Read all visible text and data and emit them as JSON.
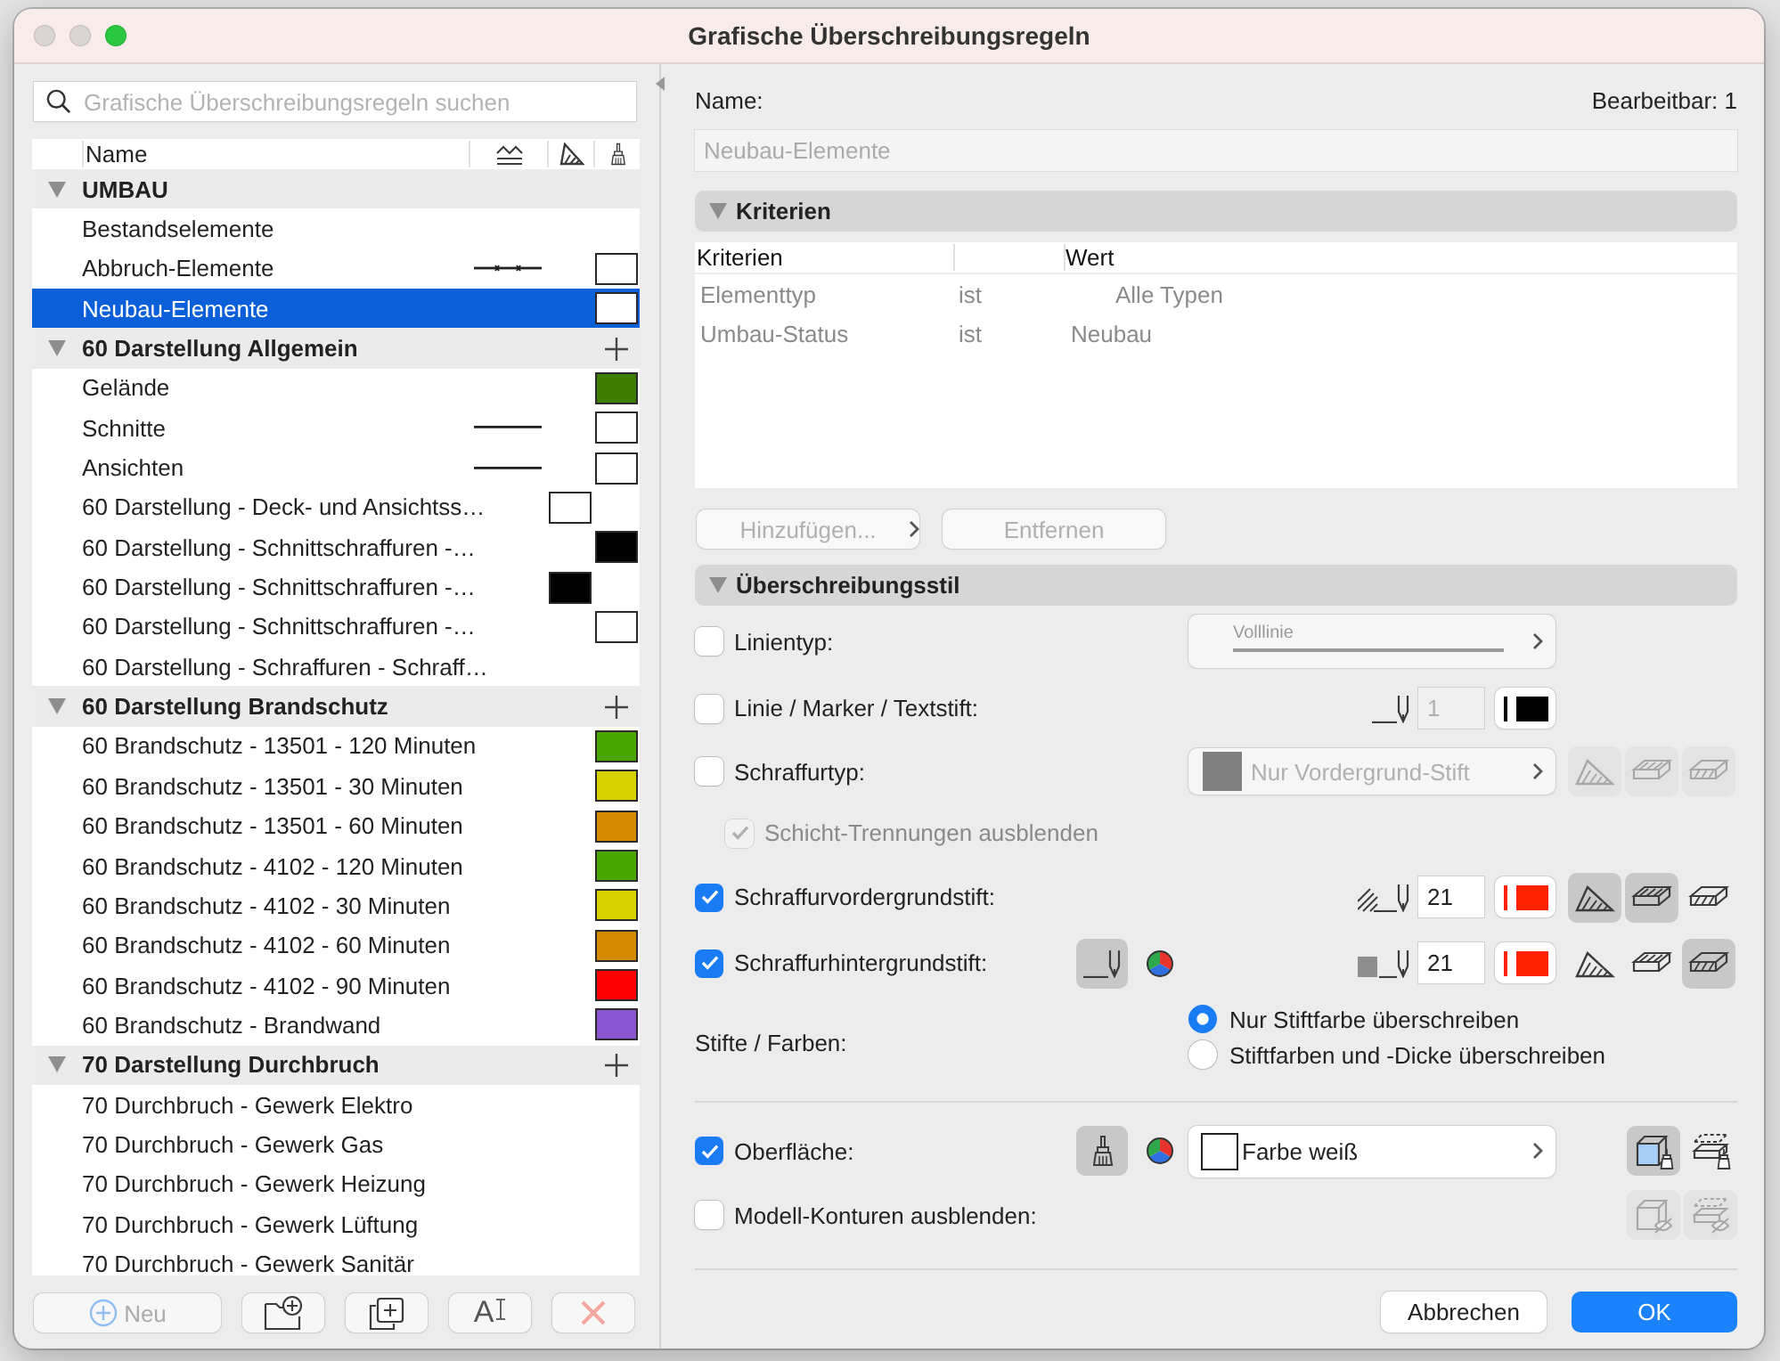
{
  "window": {
    "title": "Grafische Überschreibungsregeln",
    "controls": [
      {
        "kind": "close",
        "disabled": true
      },
      {
        "kind": "minimize",
        "disabled": true
      },
      {
        "kind": "zoom",
        "disabled": false
      }
    ]
  },
  "rule_list": {
    "search": {
      "placeholder": "Grafische Überschreibungsregeln suchen"
    },
    "columns": [
      {
        "kind": "name",
        "label": "Name"
      },
      {
        "kind": "line"
      },
      {
        "kind": "fill"
      },
      {
        "kind": "surface"
      }
    ],
    "groups": [
      {
        "label": "UMBAU",
        "expanded": true,
        "addable": false,
        "items": [
          {
            "label": "Bestandselemente",
            "selected": false
          },
          {
            "label": "Abbruch-Elemente",
            "selected": false,
            "line": {
              "kind": "crossed"
            },
            "surface": {
              "color": "#ffffff"
            }
          },
          {
            "label": "Neubau-Elemente",
            "selected": true,
            "surface": {
              "color": "#ffffff"
            }
          }
        ]
      },
      {
        "label": "60 Darstellung Allgemein",
        "expanded": true,
        "addable": true,
        "items": [
          {
            "label": "Gelände",
            "selected": false,
            "surface": {
              "color": "#3e7d00"
            }
          },
          {
            "label": "Schnitte",
            "selected": false,
            "line": {
              "kind": "solid"
            },
            "surface": {
              "color": "#ffffff"
            }
          },
          {
            "label": "Ansichten",
            "selected": false,
            "line": {
              "kind": "solid"
            },
            "surface": {
              "color": "#ffffff"
            }
          },
          {
            "label": "60 Darstellung - Deck- und Ansichtss…",
            "selected": false,
            "fill": {
              "color": "#ffffff"
            }
          },
          {
            "label": "60 Darstellung - Schnittschraffuren -…",
            "selected": false,
            "surface": {
              "color": "#000000"
            }
          },
          {
            "label": "60 Darstellung - Schnittschraffuren -…",
            "selected": false,
            "fill": {
              "color": "#000000"
            }
          },
          {
            "label": "60 Darstellung - Schnittschraffuren -…",
            "selected": false,
            "surface": {
              "color": "#ffffff"
            }
          },
          {
            "label": "60 Darstellung - Schraffuren - Schraff…",
            "selected": false
          }
        ]
      },
      {
        "label": "60 Darstellung Brandschutz",
        "expanded": true,
        "addable": true,
        "items": [
          {
            "label": "60 Brandschutz - 13501 - 120 Minuten",
            "selected": false,
            "surface": {
              "color": "#4aa600"
            }
          },
          {
            "label": "60 Brandschutz - 13501 - 30 Minuten",
            "selected": false,
            "surface": {
              "color": "#d6d200"
            }
          },
          {
            "label": "60 Brandschutz - 13501 - 60 Minuten",
            "selected": false,
            "surface": {
              "color": "#d48a00"
            }
          },
          {
            "label": "60 Brandschutz - 4102 - 120 Minuten",
            "selected": false,
            "surface": {
              "color": "#4aa600"
            }
          },
          {
            "label": "60 Brandschutz - 4102 - 30 Minuten",
            "selected": false,
            "surface": {
              "color": "#d6d200"
            }
          },
          {
            "label": "60 Brandschutz - 4102 - 60 Minuten",
            "selected": false,
            "surface": {
              "color": "#d48a00"
            }
          },
          {
            "label": "60 Brandschutz - 4102 - 90 Minuten",
            "selected": false,
            "surface": {
              "color": "#ff0000"
            }
          },
          {
            "label": "60 Brandschutz - Brandwand",
            "selected": false,
            "surface": {
              "color": "#8a55cf"
            }
          }
        ]
      },
      {
        "label": "70 Darstellung Durchbruch",
        "expanded": true,
        "addable": true,
        "items": [
          {
            "label": "70 Durchbruch - Gewerk Elektro",
            "selected": false
          },
          {
            "label": "70 Durchbruch - Gewerk Gas",
            "selected": false
          },
          {
            "label": "70 Durchbruch - Gewerk Heizung",
            "selected": false
          },
          {
            "label": "70 Durchbruch - Gewerk Lüftung",
            "selected": false
          },
          {
            "label": "70 Durchbruch - Gewerk Sanitär",
            "selected": false
          }
        ]
      }
    ],
    "buttons": [
      {
        "kind": "new",
        "label": "Neu",
        "disabled": true
      },
      {
        "kind": "new-folder",
        "disabled": false
      },
      {
        "kind": "duplicate",
        "disabled": false
      },
      {
        "kind": "rename",
        "label": "A",
        "disabled": false
      },
      {
        "kind": "delete",
        "disabled": true
      }
    ]
  },
  "details": {
    "name_label": "Name:",
    "editable_label": "Bearbeitbar: 1",
    "name_field": {
      "value": "Neubau-Elemente",
      "disabled": true
    },
    "criteria": {
      "title": "Kriterien",
      "expanded": true,
      "columns": {
        "criterion": "Kriterien",
        "value": "Wert"
      },
      "rows": [
        {
          "kind": "picker",
          "criterion": "Elementtyp",
          "operator": "ist",
          "value": "Alle Typen"
        },
        {
          "kind": "plain",
          "criterion": "Umbau-Status",
          "operator": "ist",
          "value": "Neubau"
        }
      ],
      "buttons": [
        {
          "kind": "add",
          "label": "Hinzufügen...",
          "disabled": true
        },
        {
          "kind": "remove",
          "label": "Entfernen",
          "disabled": true
        }
      ]
    },
    "style": {
      "title": "Überschreibungsstil",
      "expanded": true,
      "rows": [
        {
          "kind": "line-type",
          "label": "Linientyp:",
          "checked": false,
          "dropdown": {
            "value": "Volllinie"
          }
        },
        {
          "kind": "pen",
          "label": "Linie / Marker / Textstift:",
          "checked": false,
          "pen": {
            "kind": "pen",
            "number": "1",
            "color": "#000000"
          }
        },
        {
          "kind": "hatch-type",
          "label": "Schraffurtyp:",
          "checked": false,
          "dropdown": {
            "value": "Nur Vordergrund-Stift",
            "color": "#808080"
          },
          "modes": [
            {
              "kind": "cut",
              "selected": false
            },
            {
              "kind": "top",
              "selected": false
            },
            {
              "kind": "side",
              "selected": false
            }
          ]
        },
        {
          "kind": "sub-option",
          "label": "Schicht-Trennungen ausblenden",
          "checked": true,
          "disabled": true
        },
        {
          "kind": "pen",
          "label": "Schraffurvordergrundstift:",
          "checked": true,
          "pen": {
            "kind": "hatch",
            "number": "21",
            "color": "#ff2200"
          },
          "modes": [
            {
              "kind": "cut",
              "selected": true
            },
            {
              "kind": "top",
              "selected": true
            },
            {
              "kind": "side",
              "selected": false
            }
          ]
        },
        {
          "kind": "pen",
          "label": "Schraffurhintergrundstift:",
          "checked": true,
          "pen": {
            "kind": "fill",
            "number": "21",
            "color": "#ff2200"
          },
          "tools": [
            {
              "kind": "pen",
              "selected": true
            },
            {
              "kind": "color-wheel"
            }
          ],
          "modes": [
            {
              "kind": "cut",
              "selected": false
            },
            {
              "kind": "top",
              "selected": false
            },
            {
              "kind": "side",
              "selected": true
            }
          ]
        },
        {
          "kind": "radio",
          "label": "Stifte / Farben:",
          "options": [
            {
              "label": "Nur Stiftfarbe überschreiben",
              "selected": true
            },
            {
              "label": "Stiftfarben und -Dicke überschreiben",
              "selected": false
            }
          ]
        },
        {
          "kind": "surface",
          "label": "Oberfläche:",
          "checked": true,
          "tools": [
            {
              "kind": "brush",
              "selected": true
            },
            {
              "kind": "color-wheel"
            }
          ],
          "dropdown": {
            "value": "Farbe weiß",
            "color": "#ffffff"
          },
          "views": [
            {
              "kind": "cube-brush",
              "selected": true
            },
            {
              "kind": "layers-brush",
              "selected": false
            }
          ]
        },
        {
          "kind": "contours",
          "label": "Modell-Konturen ausblenden:",
          "checked": false,
          "views": [
            {
              "kind": "cube-eye",
              "selected": false
            },
            {
              "kind": "layers-eye",
              "selected": false
            }
          ]
        }
      ]
    }
  },
  "dialog_buttons": [
    {
      "kind": "cancel",
      "label": "Abbrechen"
    },
    {
      "kind": "ok",
      "label": "OK"
    }
  ]
}
